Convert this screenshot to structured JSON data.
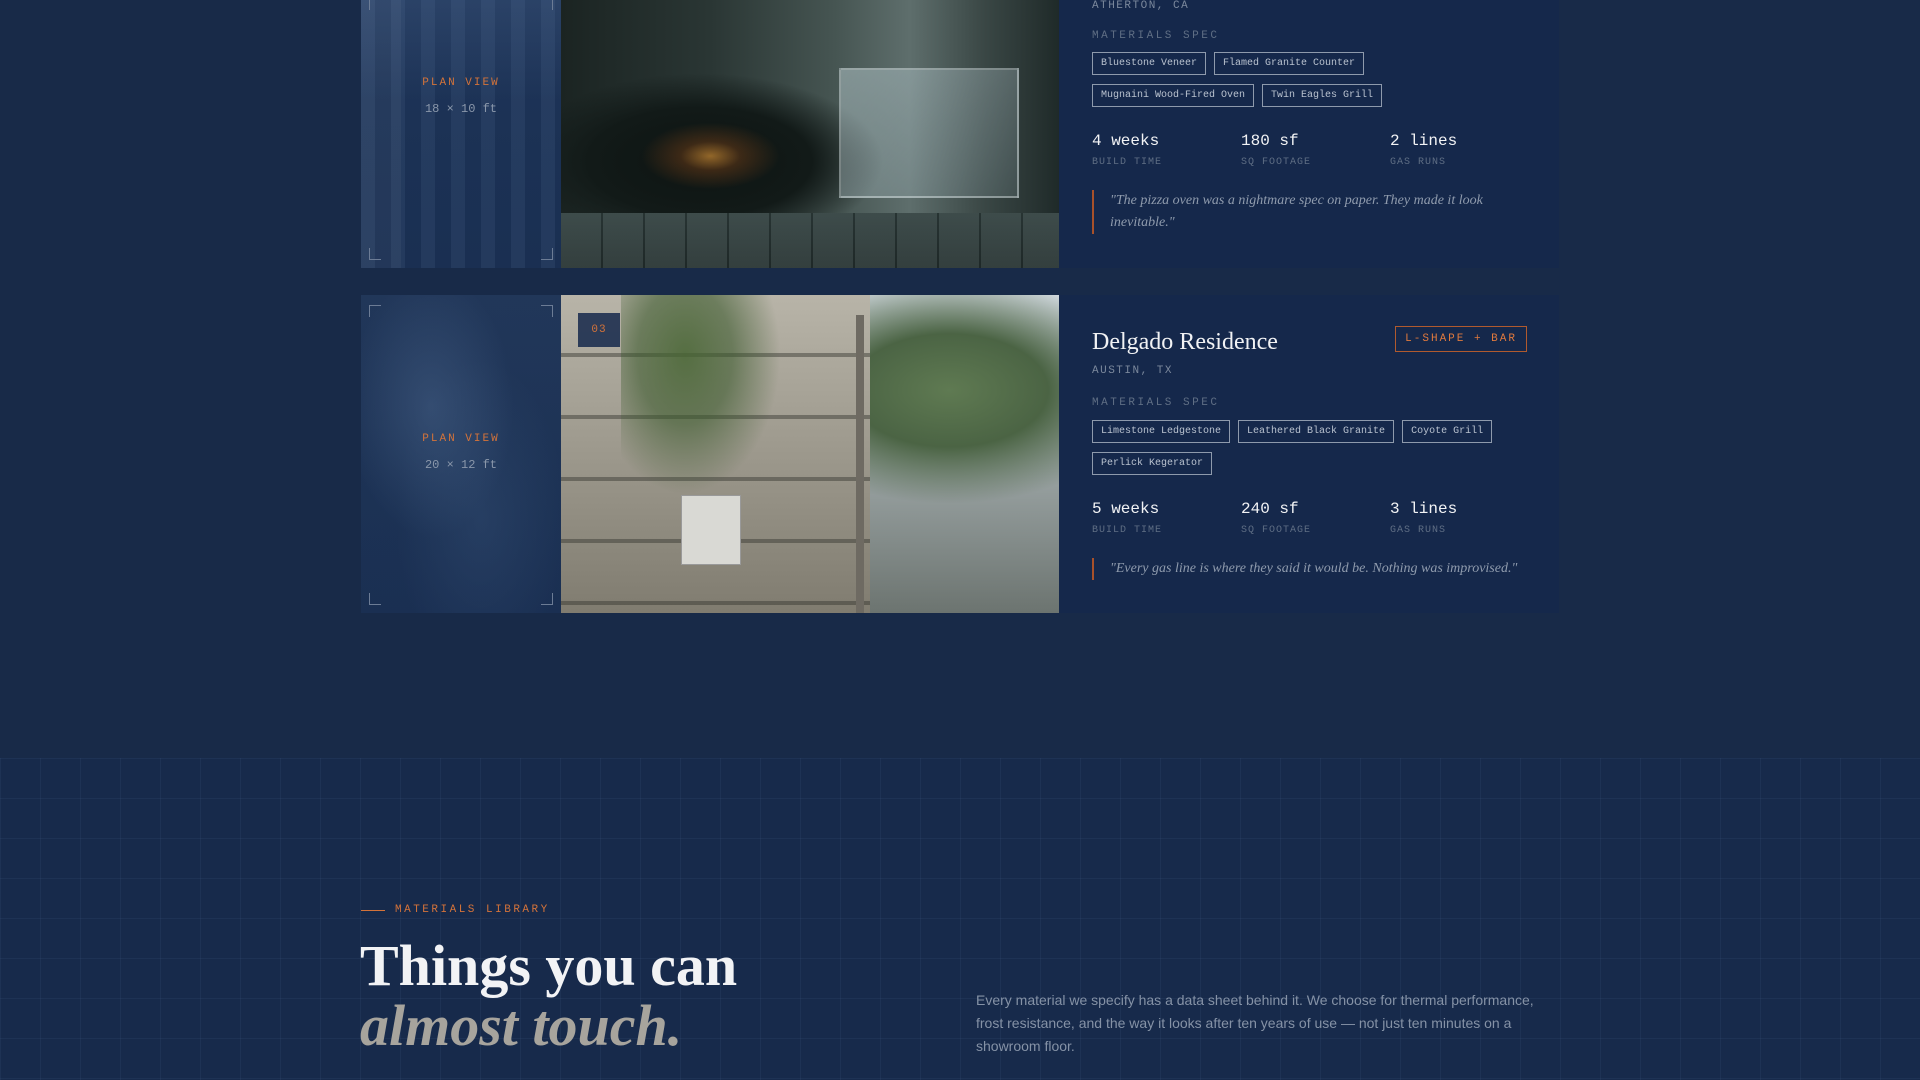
{
  "projects": [
    {
      "location": "ATHERTON, CA",
      "plan_label": "PLAN VIEW",
      "plan_dims": "18 × 10 ft",
      "spec_label": "MATERIALS SPEC",
      "materials": [
        "Bluestone Veneer",
        "Flamed Granite Counter",
        "Mugnaini Wood-Fired Oven",
        "Twin Eagles Grill"
      ],
      "stats": [
        {
          "value": "4 weeks",
          "label": "BUILD TIME"
        },
        {
          "value": "180 sf",
          "label": "SQ FOOTAGE"
        },
        {
          "value": "2 lines",
          "label": "GAS RUNS"
        }
      ],
      "quote": "\"The pizza oven was a nightmare spec on paper. They made it look inevitable.\""
    },
    {
      "number": "03",
      "title": "Delgado Residence",
      "location": "AUSTIN, TX",
      "type_badge": "L-SHAPE + BAR",
      "plan_label": "PLAN VIEW",
      "plan_dims": "20 × 12 ft",
      "spec_label": "MATERIALS SPEC",
      "materials": [
        "Limestone Ledgestone",
        "Leathered Black Granite",
        "Coyote Grill",
        "Perlick Kegerator"
      ],
      "stats": [
        {
          "value": "5 weeks",
          "label": "BUILD TIME"
        },
        {
          "value": "240 sf",
          "label": "SQ FOOTAGE"
        },
        {
          "value": "3 lines",
          "label": "GAS RUNS"
        }
      ],
      "quote": "\"Every gas line is where they said it would be. Nothing was improvised.\""
    }
  ],
  "library": {
    "eyebrow": "MATERIALS LIBRARY",
    "headline_line1": "Things you can",
    "headline_line2": "almost touch.",
    "description": "Every material we specify has a data sheet behind it. We choose for thermal performance, frost resistance, and the way it looks after ten years of use — not just ten minutes on a showroom floor."
  },
  "colors": {
    "background": "#182a48",
    "card": "#15284b",
    "accent": "#d4733a"
  }
}
